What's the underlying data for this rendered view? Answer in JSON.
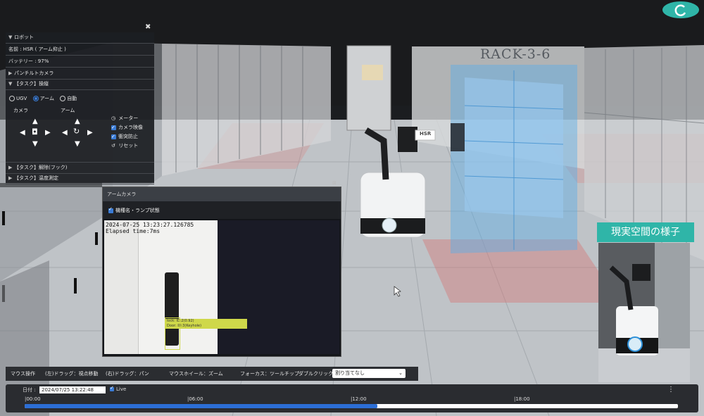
{
  "panel": {
    "close_glyph": "✖",
    "robot_header": "ロボット",
    "name_row": "名前 : HSR ( アーム抑止 )",
    "battery_row": "バッテリー : 97%",
    "pantilt_header": "パンチルトカメラ",
    "task_operation_header": "【タスク】操縦",
    "mode_options": [
      "UGV",
      "アーム",
      "自動"
    ],
    "mode_selected": "アーム",
    "camera_label": "カメラ",
    "arm_label": "アーム",
    "meter_label": "メーター",
    "camera_image_label": "カメラ映像",
    "collision_label": "衝突防止",
    "reset_label": "リセット",
    "task_hook_header": "【タスク】解除(フック)",
    "task_temp_header": "【タスク】温度測定"
  },
  "rack_label": "RACK-3-6",
  "hsr_label": "HSR",
  "arm_camera": {
    "title": "アームカメラ",
    "checkbox_label": "機種名・ランプ状態",
    "timestamp": "2024-07-25 13:23:27.126785",
    "elapsed": "Elapsed time:7ms",
    "detect_line1": "lock: ID:2(0.92)",
    "detect_line2": "Door: ID:3(Keyhole)"
  },
  "reality_label": "現実空間の様子",
  "bottom_bar": {
    "mouse_op": "マウス操作",
    "left_drag": "(左)ドラッグ：視点移動",
    "right_drag": "(右)ドラッグ：パン",
    "wheel": "マウスホイール：ズーム",
    "focus": "フォーカス：ツールチップ",
    "double_click": "ダブルクリック :",
    "select_value": "割り当てなし"
  },
  "timeline": {
    "date_label": "日付 :",
    "date_value": "2024/07/25 13:22:48",
    "live_label": "Live",
    "ticks": [
      "|00:00",
      "|06:00",
      "|12:00",
      "|18:00"
    ],
    "progress": 0.54
  },
  "colors": {
    "accent": "#3a7bd5",
    "teal_label": "#2fb5a8",
    "rack_highlight": "#5aaee6",
    "detect_box": "#cfd84a"
  }
}
